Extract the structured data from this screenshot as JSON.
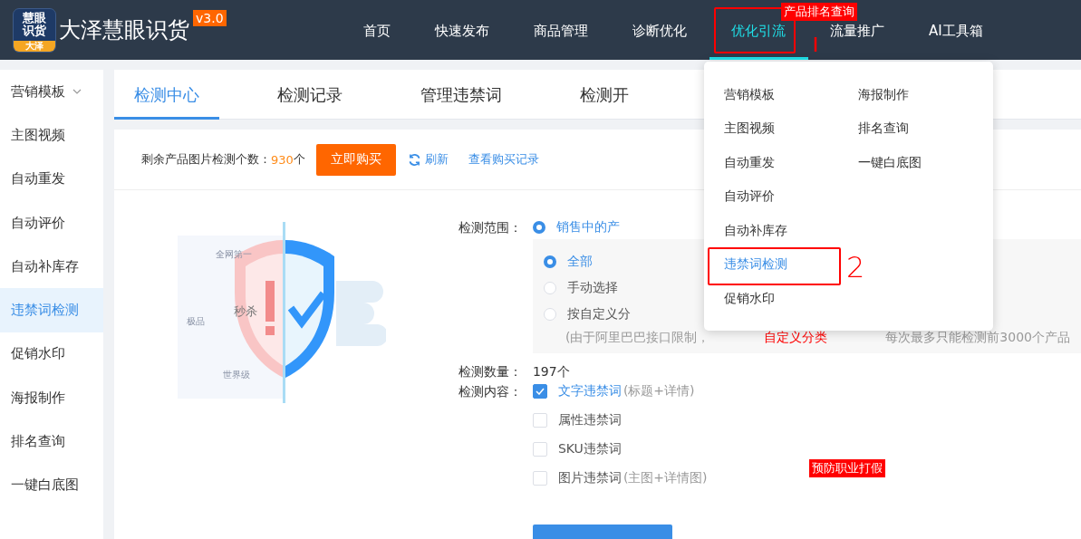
{
  "logo": {
    "icon_lines": [
      "慧眼",
      "识货"
    ],
    "icon_badge": "大泽",
    "title": "大泽慧眼识货",
    "version": "v3.0"
  },
  "nav": [
    {
      "label": "首页",
      "selected": false
    },
    {
      "label": "快速发布",
      "selected": false
    },
    {
      "label": "商品管理",
      "selected": false
    },
    {
      "label": "诊断优化",
      "selected": false
    },
    {
      "label": "优化引流",
      "selected": true
    },
    {
      "label": "流量推广",
      "selected": false
    },
    {
      "label": "AI工具箱",
      "selected": false
    }
  ],
  "sidebar": {
    "items": [
      {
        "label": "营销模板",
        "selected": false,
        "expandable": true
      },
      {
        "label": "主图视频",
        "selected": false
      },
      {
        "label": "自动重发",
        "selected": false
      },
      {
        "label": "自动评价",
        "selected": false
      },
      {
        "label": "自动补库存",
        "selected": false
      },
      {
        "label": "违禁词检测",
        "selected": true
      },
      {
        "label": "促销水印",
        "selected": false
      },
      {
        "label": "海报制作",
        "selected": false
      },
      {
        "label": "排名查询",
        "selected": false
      },
      {
        "label": "一键白底图",
        "selected": false
      }
    ]
  },
  "tabs": [
    {
      "label": "检测中心",
      "selected": true
    },
    {
      "label": "检测记录",
      "selected": false
    },
    {
      "label": "管理违禁词",
      "selected": false
    },
    {
      "label": "检测开",
      "selected": false
    }
  ],
  "quota": {
    "label": "剩余产品图片检测个数：",
    "count": "930",
    "unit": "个",
    "buy_button": "立即购买",
    "refresh": "刷新",
    "history_link": "查看购买记录"
  },
  "illustration": {
    "words": [
      "全网第一",
      "秒杀",
      "极品",
      "世界级"
    ]
  },
  "form": {
    "scope": {
      "label": "检测范围：",
      "option": {
        "label": "销售中的产",
        "selected": true
      },
      "sub_options": [
        {
          "label": "全部",
          "selected": true
        },
        {
          "label": "手动选择",
          "selected": false
        },
        {
          "label": "按自定义分",
          "selected": false
        }
      ],
      "note": [
        {
          "text": "(由于阿里巴巴接口限制，",
          "kind": "plain"
        },
        {
          "text": "自定义分类",
          "kind": "warning"
        },
        {
          "text": "每次最多只能检测前3000个产品",
          "kind": "plain"
        }
      ]
    },
    "count": {
      "label": "检测数量：",
      "value": "197个"
    },
    "content": {
      "label": "检测内容：",
      "options": [
        {
          "label": "文字违禁词",
          "hint": "(标题+详情)",
          "checked": true
        },
        {
          "label": "属性违禁词",
          "checked": false
        },
        {
          "label": "SKU违禁词",
          "checked": false
        },
        {
          "label": "图片违禁词",
          "hint": "(主图+详情图)",
          "checked": false
        }
      ]
    }
  },
  "dropdown": {
    "columns": [
      [
        {
          "label": "营销模板",
          "selected": false
        },
        {
          "label": "主图视频",
          "selected": false
        },
        {
          "label": "自动重发",
          "selected": false
        },
        {
          "label": "自动评价",
          "selected": false
        },
        {
          "label": "自动补库存",
          "selected": false
        },
        {
          "label": "违禁词检测",
          "selected": true
        },
        {
          "label": "促销水印",
          "selected": false
        }
      ],
      [
        {
          "label": "海报制作",
          "selected": false
        },
        {
          "label": "排名查询",
          "selected": false
        },
        {
          "label": "一键白底图",
          "selected": false
        }
      ]
    ]
  },
  "annotations": [
    {
      "kind": "box"
    },
    {
      "kind": "tag",
      "text": "产品排名查询"
    },
    {
      "kind": "stroke"
    },
    {
      "kind": "box"
    },
    {
      "kind": "number",
      "text": "2"
    },
    {
      "kind": "tag",
      "text": "预防职业打假"
    }
  ]
}
